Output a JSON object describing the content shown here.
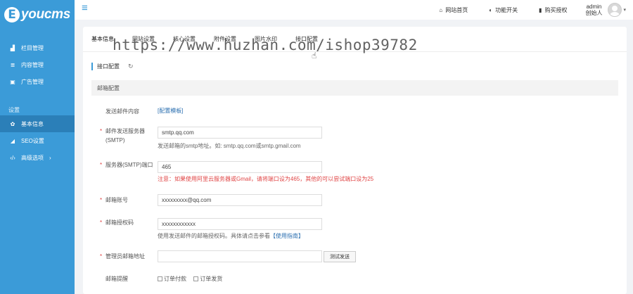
{
  "brand": {
    "logo_letter": "E",
    "logo_text": "youcms"
  },
  "sidebar": {
    "items": [
      {
        "icon": "column-icon",
        "label": "栏目管理"
      },
      {
        "icon": "list-icon",
        "label": "内容管理"
      },
      {
        "icon": "image-icon",
        "label": "广告管理"
      }
    ],
    "section_label": "设置",
    "settings_items": [
      {
        "icon": "gear-icon",
        "label": "基本信息"
      },
      {
        "icon": "send-icon",
        "label": "SEO设置"
      },
      {
        "icon": "code-icon",
        "label": "高级选项",
        "chevron": "›"
      }
    ]
  },
  "header": {
    "links": [
      {
        "icon": "home-icon",
        "label": "网站首页"
      },
      {
        "icon": "toggle-icon",
        "label": "功能开关"
      },
      {
        "icon": "bookmark-icon",
        "label": "购买授权"
      }
    ],
    "admin_name": "admin",
    "admin_role": "创始人"
  },
  "tabs": [
    "基本信息",
    "网站设置",
    "核心设置",
    "附件设置",
    "图片水印",
    "接口配置"
  ],
  "watermark": "https://www.huzhan.com/ishop39782",
  "subtab": "接口配置",
  "section_title": "邮箱配置",
  "form": {
    "template_label": "发送邮件内容",
    "template_link": "[配置模板]",
    "smtp_server_label": "邮件发送服务器(SMTP)",
    "smtp_server_value": "smtp.qq.com",
    "smtp_server_hint": "发送邮箱的smtp地址。如: smtp.qq.com或smtp.gmail.com",
    "smtp_port_label": "服务器(SMTP)端口",
    "smtp_port_value": "465",
    "smtp_port_hint": "注意：如果使用阿里云服务器或Gmail，请将端口设为465，其他的可以尝试端口设为25",
    "account_label": "邮箱账号",
    "account_value": "xxxxxxxxx@qq.com",
    "auth_label": "邮箱授权码",
    "auth_value": "xxxxxxxxxxxx",
    "auth_hint_text": "使用发送邮件的邮箱授权码。具体请点击参看",
    "auth_hint_link": "【使用指南】",
    "admin_email_label": "管理员邮箱地址",
    "admin_email_value": "",
    "test_button": "测试发送",
    "remind_label": "邮箱提醒",
    "remind_options": [
      "订单付款",
      "订单发货"
    ]
  },
  "colors": {
    "sidebar": "#3b9bd8",
    "accent": "#2b6fb0",
    "warning": "#e04545"
  }
}
